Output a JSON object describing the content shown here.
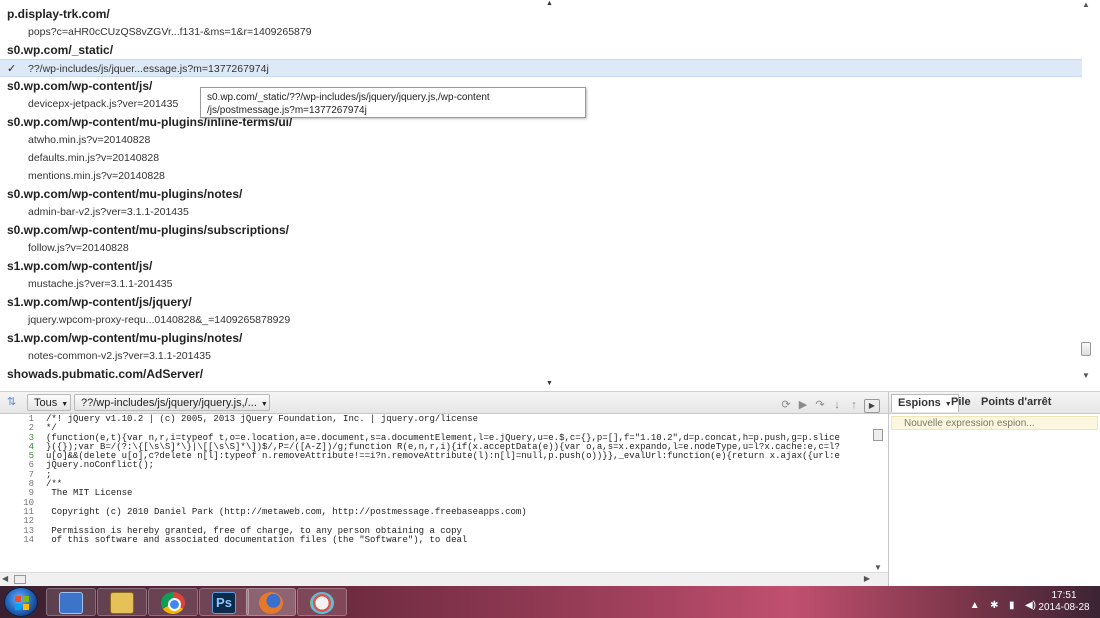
{
  "script_list": {
    "rows": [
      {
        "kind": "group",
        "text": "p.display-trk.com/"
      },
      {
        "kind": "item",
        "text": "pops?c=aHR0cCUzQS8vZGVr...f131-&ms=1&r=1409265879"
      },
      {
        "kind": "group",
        "text": "s0.wp.com/_static/"
      },
      {
        "kind": "item",
        "text": "??/wp-includes/js/jquer...essage.js?m=1377267974j",
        "selected": true,
        "check": "✓"
      },
      {
        "kind": "group",
        "text": "s0.wp.com/wp-content/js/"
      },
      {
        "kind": "item",
        "text": "devicepx-jetpack.js?ver=201435"
      },
      {
        "kind": "group",
        "text": "s0.wp.com/wp-content/mu-plugins/inline-terms/ui/"
      },
      {
        "kind": "item",
        "text": "atwho.min.js?v=20140828"
      },
      {
        "kind": "item",
        "text": "defaults.min.js?v=20140828"
      },
      {
        "kind": "item",
        "text": "mentions.min.js?v=20140828"
      },
      {
        "kind": "group",
        "text": "s0.wp.com/wp-content/mu-plugins/notes/"
      },
      {
        "kind": "item",
        "text": "admin-bar-v2.js?ver=3.1.1-201435"
      },
      {
        "kind": "group",
        "text": "s0.wp.com/wp-content/mu-plugins/subscriptions/"
      },
      {
        "kind": "item",
        "text": "follow.js?v=20140828"
      },
      {
        "kind": "group",
        "text": "s1.wp.com/wp-content/js/"
      },
      {
        "kind": "item",
        "text": "mustache.js?ver=3.1.1-201435"
      },
      {
        "kind": "group",
        "text": "s1.wp.com/wp-content/js/jquery/"
      },
      {
        "kind": "item",
        "text": "jquery.wpcom-proxy-requ...0140828&_=1409265878929"
      },
      {
        "kind": "group",
        "text": "s1.wp.com/wp-content/mu-plugins/notes/"
      },
      {
        "kind": "item",
        "text": "notes-common-v2.js?ver=3.1.1-201435"
      },
      {
        "kind": "group",
        "text": "showads.pubmatic.com/AdServer/"
      }
    ],
    "tooltip_line1": "s0.wp.com/_static/??/wp-includes/js/jquery/jquery.js,/wp-content",
    "tooltip_line2": "/js/postmessage.js?m=1377267974j"
  },
  "toolbar": {
    "filter_label": "Tous",
    "script_label": "??/wp-includes/js/jquery/jquery.js,/...",
    "icons": [
      "refresh-icon",
      "continue-icon",
      "step-over-icon",
      "step-into-icon",
      "step-out-icon",
      "collapse-panel-icon"
    ]
  },
  "code": {
    "lines": [
      {
        "n": "1",
        "text": "/*! jQuery v1.10.2 | (c) 2005, 2013 jQuery Foundation, Inc. | jquery.org/license"
      },
      {
        "n": "2",
        "text": "*/"
      },
      {
        "n": "3",
        "text": "(function(e,t){var n,r,i=typeof t,o=e.location,a=e.document,s=a.documentElement,l=e.jQuery,u=e.$,c={},p=[],f=\"1.10.2\",d=p.concat,h=p.push,g=p.slice",
        "hl": true
      },
      {
        "n": "4",
        "text": "}({});var B=/(?:\\{[\\s\\S]*\\}|\\[[\\s\\S]*\\])$/,P=/([A-Z])/g;function R(e,n,r,i){if(x.acceptData(e)){var o,a,s=x.expando,l=e.nodeType,u=l?x.cache:e,c=l?",
        "hl": true
      },
      {
        "n": "5",
        "text": "u[o]&&(delete u[o],c?delete n[l]:typeof n.removeAttribute!==i?n.removeAttribute(l):n[l]=null,p.push(o))}},_evalUrl:function(e){return x.ajax({url:e",
        "hl": true
      },
      {
        "n": "6",
        "text": "jQuery.noConflict();"
      },
      {
        "n": "7",
        "text": ";"
      },
      {
        "n": "8",
        "text": "/**"
      },
      {
        "n": "9",
        "text": " The MIT License"
      },
      {
        "n": "10",
        "text": ""
      },
      {
        "n": "11",
        "text": " Copyright (c) 2010 Daniel Park (http://metaweb.com, http://postmessage.freebaseapps.com)"
      },
      {
        "n": "12",
        "text": ""
      },
      {
        "n": "13",
        "text": " Permission is hereby granted, free of charge, to any person obtaining a copy"
      },
      {
        "n": "14",
        "text": " of this software and associated documentation files (the \"Software\"), to deal"
      }
    ]
  },
  "watch": {
    "tab_watch": "Espions",
    "tab_stack": "Pile",
    "tab_breakpoints": "Points d'arrêt",
    "new_expression": "Nouvelle expression espion..."
  },
  "taskbar": {
    "apps": [
      "media-player-icon",
      "file-explorer-icon",
      "chrome-icon",
      "photoshop-icon",
      "firefox-icon",
      "paint-icon"
    ],
    "ps_label": "Ps",
    "clock_time": "17:51",
    "clock_date": "2014-08-28"
  }
}
